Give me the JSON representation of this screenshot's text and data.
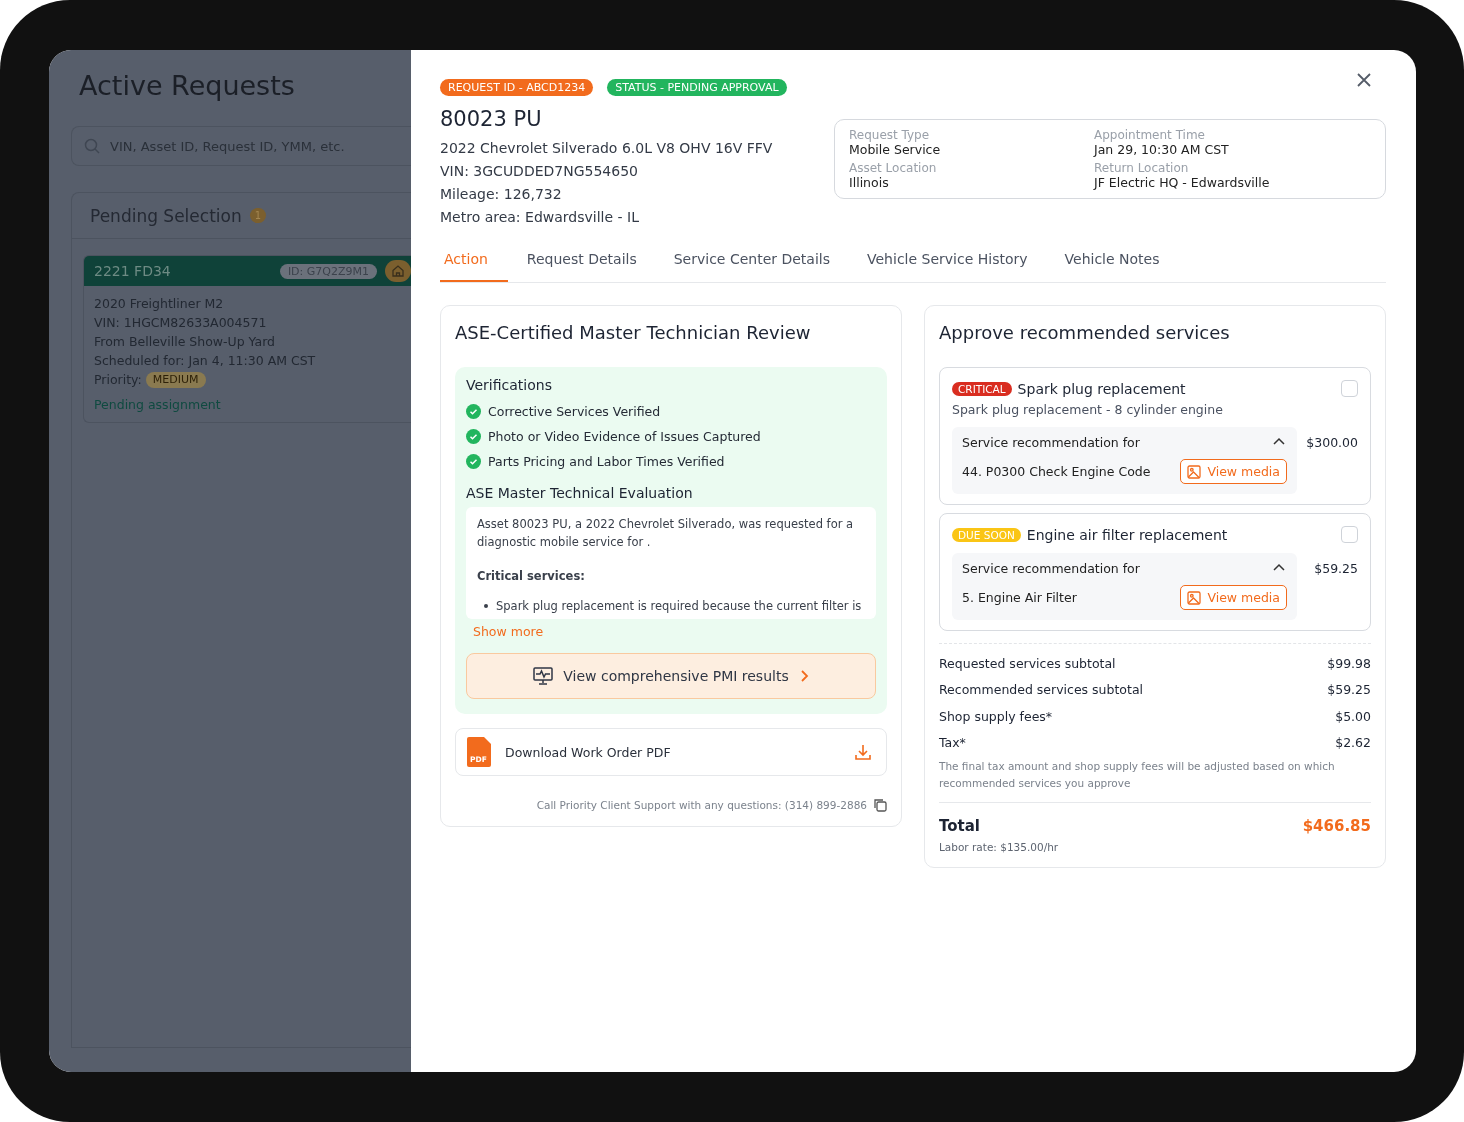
{
  "sidebar": {
    "title": "Active Requests",
    "search": {
      "placeholder": "VIN, Asset ID, Request ID, YMM, etc."
    },
    "section": {
      "title": "Pending Selection",
      "count": "1"
    },
    "card": {
      "plate": "2221 FD34",
      "id": "ID: G7Q2Z9M1",
      "lines": [
        "2020 Freightliner M2",
        "VIN: 1HGCM82633A004571",
        "From Belleville Show-Up Yard",
        "Scheduled for: Jan 4, 11:30 AM CST"
      ],
      "priority_label": "Priority:",
      "priority": "MEDIUM",
      "status": "Pending assignment"
    }
  },
  "modal": {
    "badges": [
      {
        "text": "REQUEST ID - ABCD1234",
        "color": "#f26b1d"
      },
      {
        "text": "STATUS - PENDING APPROVAL",
        "color": "#22b55e"
      }
    ],
    "vehicle": {
      "title": "80023 PU",
      "lines": [
        "2022 Chevrolet Silverado 6.0L V8 OHV 16V FFV",
        "VIN: 3GCUDDED7NG554650",
        "Mileage: 126,732",
        "Metro area: Edwardsville - IL"
      ]
    },
    "info": [
      {
        "label": "Request Type",
        "value": "Mobile Service"
      },
      {
        "label": "Appointment Time",
        "value": "Jan 29, 10:30 AM CST"
      },
      {
        "label": "Asset Location",
        "value": "Illinois"
      },
      {
        "label": "Return Location",
        "value": "JF Electric HQ - Edwardsville"
      }
    ],
    "tabs": [
      {
        "label": "Action",
        "selected": true
      },
      {
        "label": "Request Details",
        "selected": false
      },
      {
        "label": "Service Center Details",
        "selected": false
      },
      {
        "label": "Vehicle Service History",
        "selected": false
      },
      {
        "label": "Vehicle Notes",
        "selected": false
      }
    ],
    "review": {
      "title": "ASE-Certified Master Technician Review",
      "verifications_title": "Verifications",
      "verifications": [
        {
          "label": "Corrective Services Verified",
          "checked": true
        },
        {
          "label": "Photo or Video Evidence of Issues Captured",
          "checked": true
        },
        {
          "label": "Parts Pricing and Labor Times Verified",
          "checked": true
        }
      ],
      "evaluation_title": "ASE Master Technical Evaluation",
      "evaluation": "Asset 80023 PU, a 2022 Chevrolet Silverado, was requested for a diagnostic mobile service for .",
      "critical_title": "Critical services:",
      "bullet": "Spark plug replacement is required because the current filter is",
      "show_more": "Show more",
      "pmi_button": "View comprehensive PMI results",
      "pdf_icon": "PDF",
      "download": "Download Work Order PDF",
      "support": "Call Priority Client Support with any questions: (314) 899-2886"
    },
    "services": {
      "title": "Approve recommended services",
      "items": [
        {
          "tag": "CRITICAL",
          "color": "#d92d20",
          "name": "Spark plug replacement",
          "description": "Spark plug replacement - 8 cylinder engine",
          "checked": false,
          "rec_title": "Service recommendation for",
          "expanded": true,
          "rec_item": "44. P0300 Check Engine Code",
          "media": "View media",
          "price": "$300.00"
        },
        {
          "tag": "DUE SOON",
          "color": "#fac515",
          "name": "Engine air filter replacement",
          "checked": false,
          "rec_title": "Service recommendation for",
          "expanded": true,
          "rec_item": "5. Engine Air Filter",
          "media": "View media",
          "price": "$59.25"
        }
      ],
      "summary": [
        {
          "label": "Requested services subtotal",
          "value": "$99.98"
        },
        {
          "label": "Recommended services subtotal",
          "value": "$59.25"
        },
        {
          "label": "Shop supply fees*",
          "value": "$5.00"
        },
        {
          "label": "Tax*",
          "value": "$2.62"
        }
      ],
      "note": "The final tax amount and shop supply fees will be adjusted based on which recommended services you approve",
      "total_label": "Total",
      "total": "$466.85",
      "labor_rate": "Labor rate: $135.00/hr"
    }
  }
}
